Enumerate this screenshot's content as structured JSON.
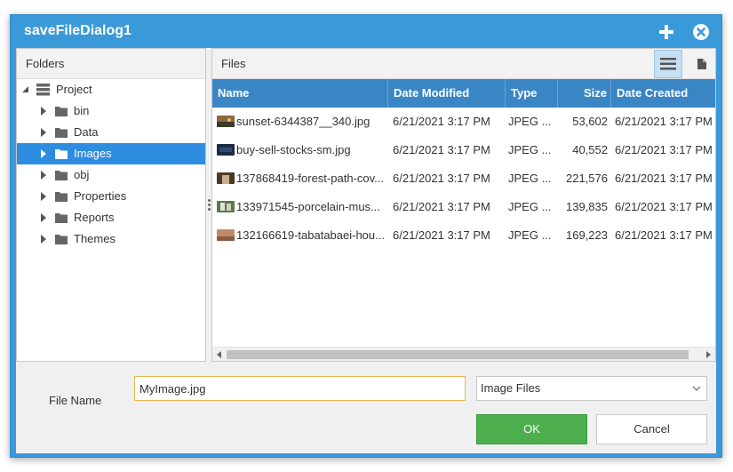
{
  "dialog": {
    "title": "saveFileDialog1"
  },
  "folders": {
    "header": "Folders",
    "root": "Project",
    "items": [
      {
        "label": "bin"
      },
      {
        "label": "Data"
      },
      {
        "label": "Images"
      },
      {
        "label": "obj"
      },
      {
        "label": "Properties"
      },
      {
        "label": "Reports"
      },
      {
        "label": "Themes"
      }
    ],
    "selected": "Images"
  },
  "files": {
    "header": "Files",
    "columns": [
      "Name",
      "Date Modified",
      "Type",
      "Size",
      "Date Created"
    ],
    "rows": [
      {
        "name": "sunset-6344387__340.jpg",
        "modified": "6/21/2021 3:17 PM",
        "type": "JPEG ...",
        "size": "53,602",
        "created": "6/21/2021 3:17 PM"
      },
      {
        "name": "buy-sell-stocks-sm.jpg",
        "modified": "6/21/2021 3:17 PM",
        "type": "JPEG ...",
        "size": "40,552",
        "created": "6/21/2021 3:17 PM"
      },
      {
        "name": "137868419-forest-path-cov...",
        "modified": "6/21/2021 3:17 PM",
        "type": "JPEG ...",
        "size": "221,576",
        "created": "6/21/2021 3:17 PM"
      },
      {
        "name": "133971545-porcelain-mus...",
        "modified": "6/21/2021 3:17 PM",
        "type": "JPEG ...",
        "size": "139,835",
        "created": "6/21/2021 3:17 PM"
      },
      {
        "name": "132166619-tabatabaei-hou...",
        "modified": "6/21/2021 3:17 PM",
        "type": "JPEG ...",
        "size": "169,223",
        "created": "6/21/2021 3:17 PM"
      }
    ]
  },
  "form": {
    "file_name_label": "File Name",
    "file_name_value": "MyImage.jpg",
    "file_type": "Image Files",
    "ok_label": "OK",
    "cancel_label": "Cancel"
  },
  "colors": {
    "titlebar": "#3a9ad9",
    "grid_header": "#3a86c4",
    "selection": "#2e8de0",
    "ok_button": "#4cae4c"
  }
}
